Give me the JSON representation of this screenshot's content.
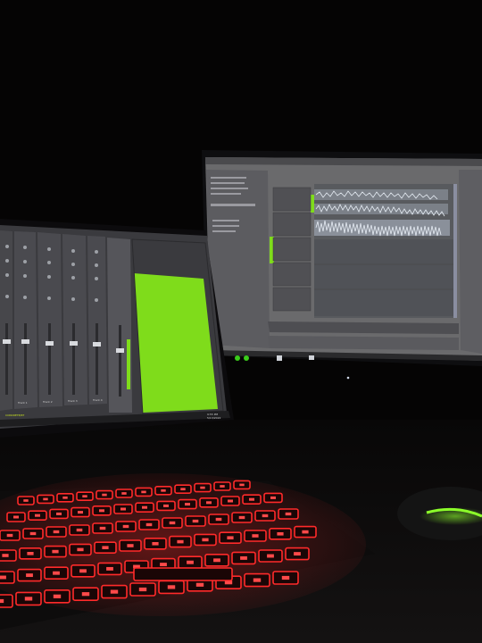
{
  "scene": {
    "description_free": true,
    "colors": {
      "room": "#050404",
      "monitor_bezel": "#0e0e10",
      "monitor_screen": "#6e6e6e",
      "daw_panel": "#5b5b5e",
      "mixer_bg": "#3a3a3c",
      "green_meter": "#7fdc1b",
      "waveform": "#c9d2e0",
      "keyboard_backlight": "#ff2a2a",
      "keyboard_body": "#111111",
      "mouse_glow": "#8cff2a"
    }
  },
  "laptop_screen": {
    "app": "mixer",
    "channel_labels": [
      "Track 1",
      "Track 2",
      "Track 3",
      "Track 4"
    ],
    "green_label": "CONCRETE/RT",
    "clock": "9:55 PM",
    "date": "5/13/2022"
  },
  "monitor_screen": {
    "app": "daw-multitrack",
    "track_count": 6,
    "icons": [
      "record-icon",
      "play-icon",
      "stop-icon",
      "folder-icon"
    ]
  }
}
